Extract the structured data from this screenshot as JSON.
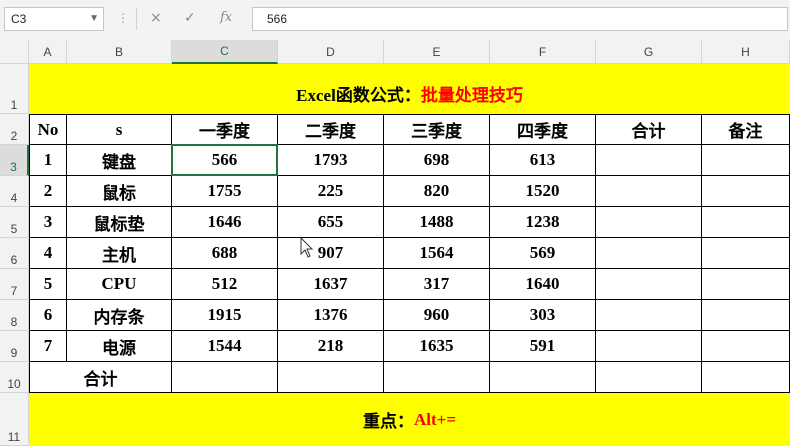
{
  "toolbar": {
    "name_box": "C3",
    "formula": "566",
    "cancel_icon": "×",
    "enter_icon": "✓",
    "fx_label": "fx"
  },
  "columns": [
    "A",
    "B",
    "C",
    "D",
    "E",
    "F",
    "G",
    "H"
  ],
  "rows": [
    "1",
    "2",
    "3",
    "4",
    "5",
    "6",
    "7",
    "8",
    "9",
    "10",
    "11"
  ],
  "title": {
    "black": "Excel函数公式：",
    "red": "批量处理技巧"
  },
  "header": [
    "No",
    "s",
    "一季度",
    "二季度",
    "三季度",
    "四季度",
    "合计",
    "备注"
  ],
  "data": [
    [
      "1",
      "键盘",
      "566",
      "1793",
      "698",
      "613"
    ],
    [
      "2",
      "鼠标",
      "1755",
      "225",
      "820",
      "1520"
    ],
    [
      "3",
      "鼠标垫",
      "1646",
      "655",
      "1488",
      "1238"
    ],
    [
      "4",
      "主机",
      "688",
      "907",
      "1564",
      "569"
    ],
    [
      "5",
      "CPU",
      "512",
      "1637",
      "317",
      "1640"
    ],
    [
      "6",
      "内存条",
      "1915",
      "1376",
      "960",
      "303"
    ],
    [
      "7",
      "电源",
      "1544",
      "218",
      "1635",
      "591"
    ]
  ],
  "total_label": "合计",
  "footer": {
    "black": "重点：",
    "red": "Alt+="
  },
  "colors": {
    "highlight": "#ffff00",
    "accent_red": "#ff0000",
    "excel_green": "#217346"
  }
}
